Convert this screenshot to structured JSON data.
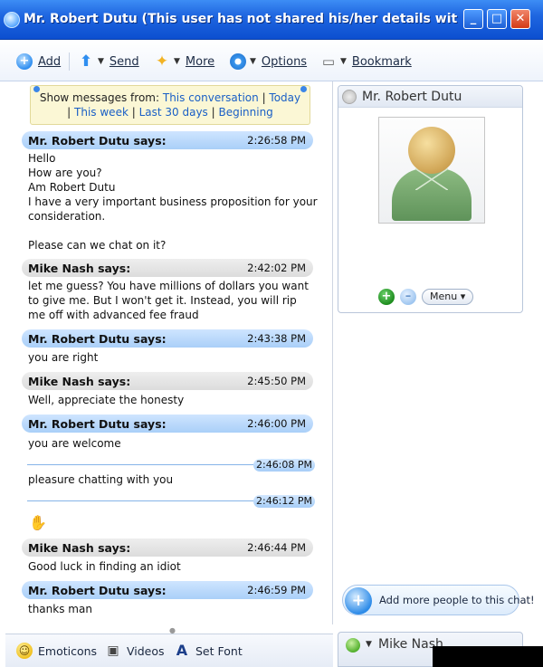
{
  "window": {
    "title": "Mr. Robert Dutu (This user has not shared his/her details wit...",
    "buttons": {
      "minimize": "_",
      "maximize": "□",
      "close": "✕"
    }
  },
  "toolbar": {
    "add": "Add",
    "send": "Send",
    "more": "More",
    "options": "Options",
    "bookmark": "Bookmark"
  },
  "filter": {
    "prefix": "Show messages from:",
    "links": [
      "This conversation",
      "Today",
      "This week",
      "Last 30 days",
      "Beginning"
    ]
  },
  "messages": [
    {
      "sender": "Mr. Robert Dutu says:",
      "time": "2:26:58 PM",
      "lines": [
        "Hello",
        "How are you?",
        "Am Robert Dutu",
        "I have a very important business proposition for your",
        "consideration.",
        "",
        "Please can we chat on it?"
      ]
    },
    {
      "sender": "Mike Nash says:",
      "time": "2:42:02 PM",
      "lines": [
        "let me guess?  You have millions of dollars you want",
        "to give me.  But I won't get it.  Instead, you will rip",
        "me off with advanced fee fraud"
      ]
    },
    {
      "sender": "Mr. Robert Dutu says:",
      "time": "2:43:38 PM",
      "lines": [
        "you are right"
      ]
    },
    {
      "sender": "Mike Nash says:",
      "time": "2:45:50 PM",
      "lines": [
        "Well, appreciate the honesty"
      ]
    },
    {
      "sender": "Mr. Robert Dutu says:",
      "time": "2:46:00 PM",
      "lines": [
        "you are welcome"
      ]
    },
    {
      "time": "2:46:08 PM",
      "lines": [
        "pleasure chatting with you"
      ]
    },
    {
      "time": "2:46:12 PM",
      "emoticon": "handshake"
    },
    {
      "sender": "Mike Nash says:",
      "time": "2:46:44 PM",
      "lines": [
        "Good luck in finding an idiot"
      ]
    },
    {
      "sender": "Mr. Robert Dutu says:",
      "time": "2:46:59 PM",
      "lines": [
        "thanks man"
      ]
    }
  ],
  "bottombar": {
    "emoticons": "Emoticons",
    "videos": "Videos",
    "setfont": "Set Font"
  },
  "contact": {
    "name": "Mr. Robert Dutu",
    "menu": "Menu"
  },
  "addmore": "Add more people to this chat!",
  "self": {
    "name": "Mike Nash"
  },
  "colors": {
    "titlebar": "#1f66e0",
    "blueHeader": "#a9cff8",
    "grayHeader": "#dcdcdc",
    "filterBg": "#fbf7d5",
    "link": "#1a5fc6"
  }
}
